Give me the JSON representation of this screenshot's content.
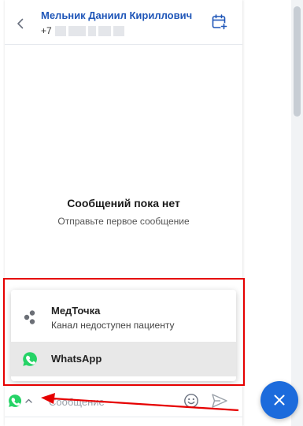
{
  "header": {
    "contact_name": "Мельник Даниил Кириллович",
    "phone_prefix": "+7"
  },
  "empty_state": {
    "title": "Сообщений пока нет",
    "subtitle": "Отправьте первое сообщение"
  },
  "channel_menu": {
    "items": [
      {
        "label": "МедТочка",
        "sublabel": "Канал недоступен пациенту",
        "icon": "medtochka-icon",
        "selected": false
      },
      {
        "label": "WhatsApp",
        "icon": "whatsapp-icon",
        "selected": true
      }
    ]
  },
  "composer": {
    "placeholder": "Сообщение",
    "selected_channel_icon": "whatsapp-icon"
  },
  "colors": {
    "accent": "#1f56b8",
    "fab": "#1c6bdc",
    "whatsapp": "#25d366",
    "annotation": "#e60000"
  }
}
